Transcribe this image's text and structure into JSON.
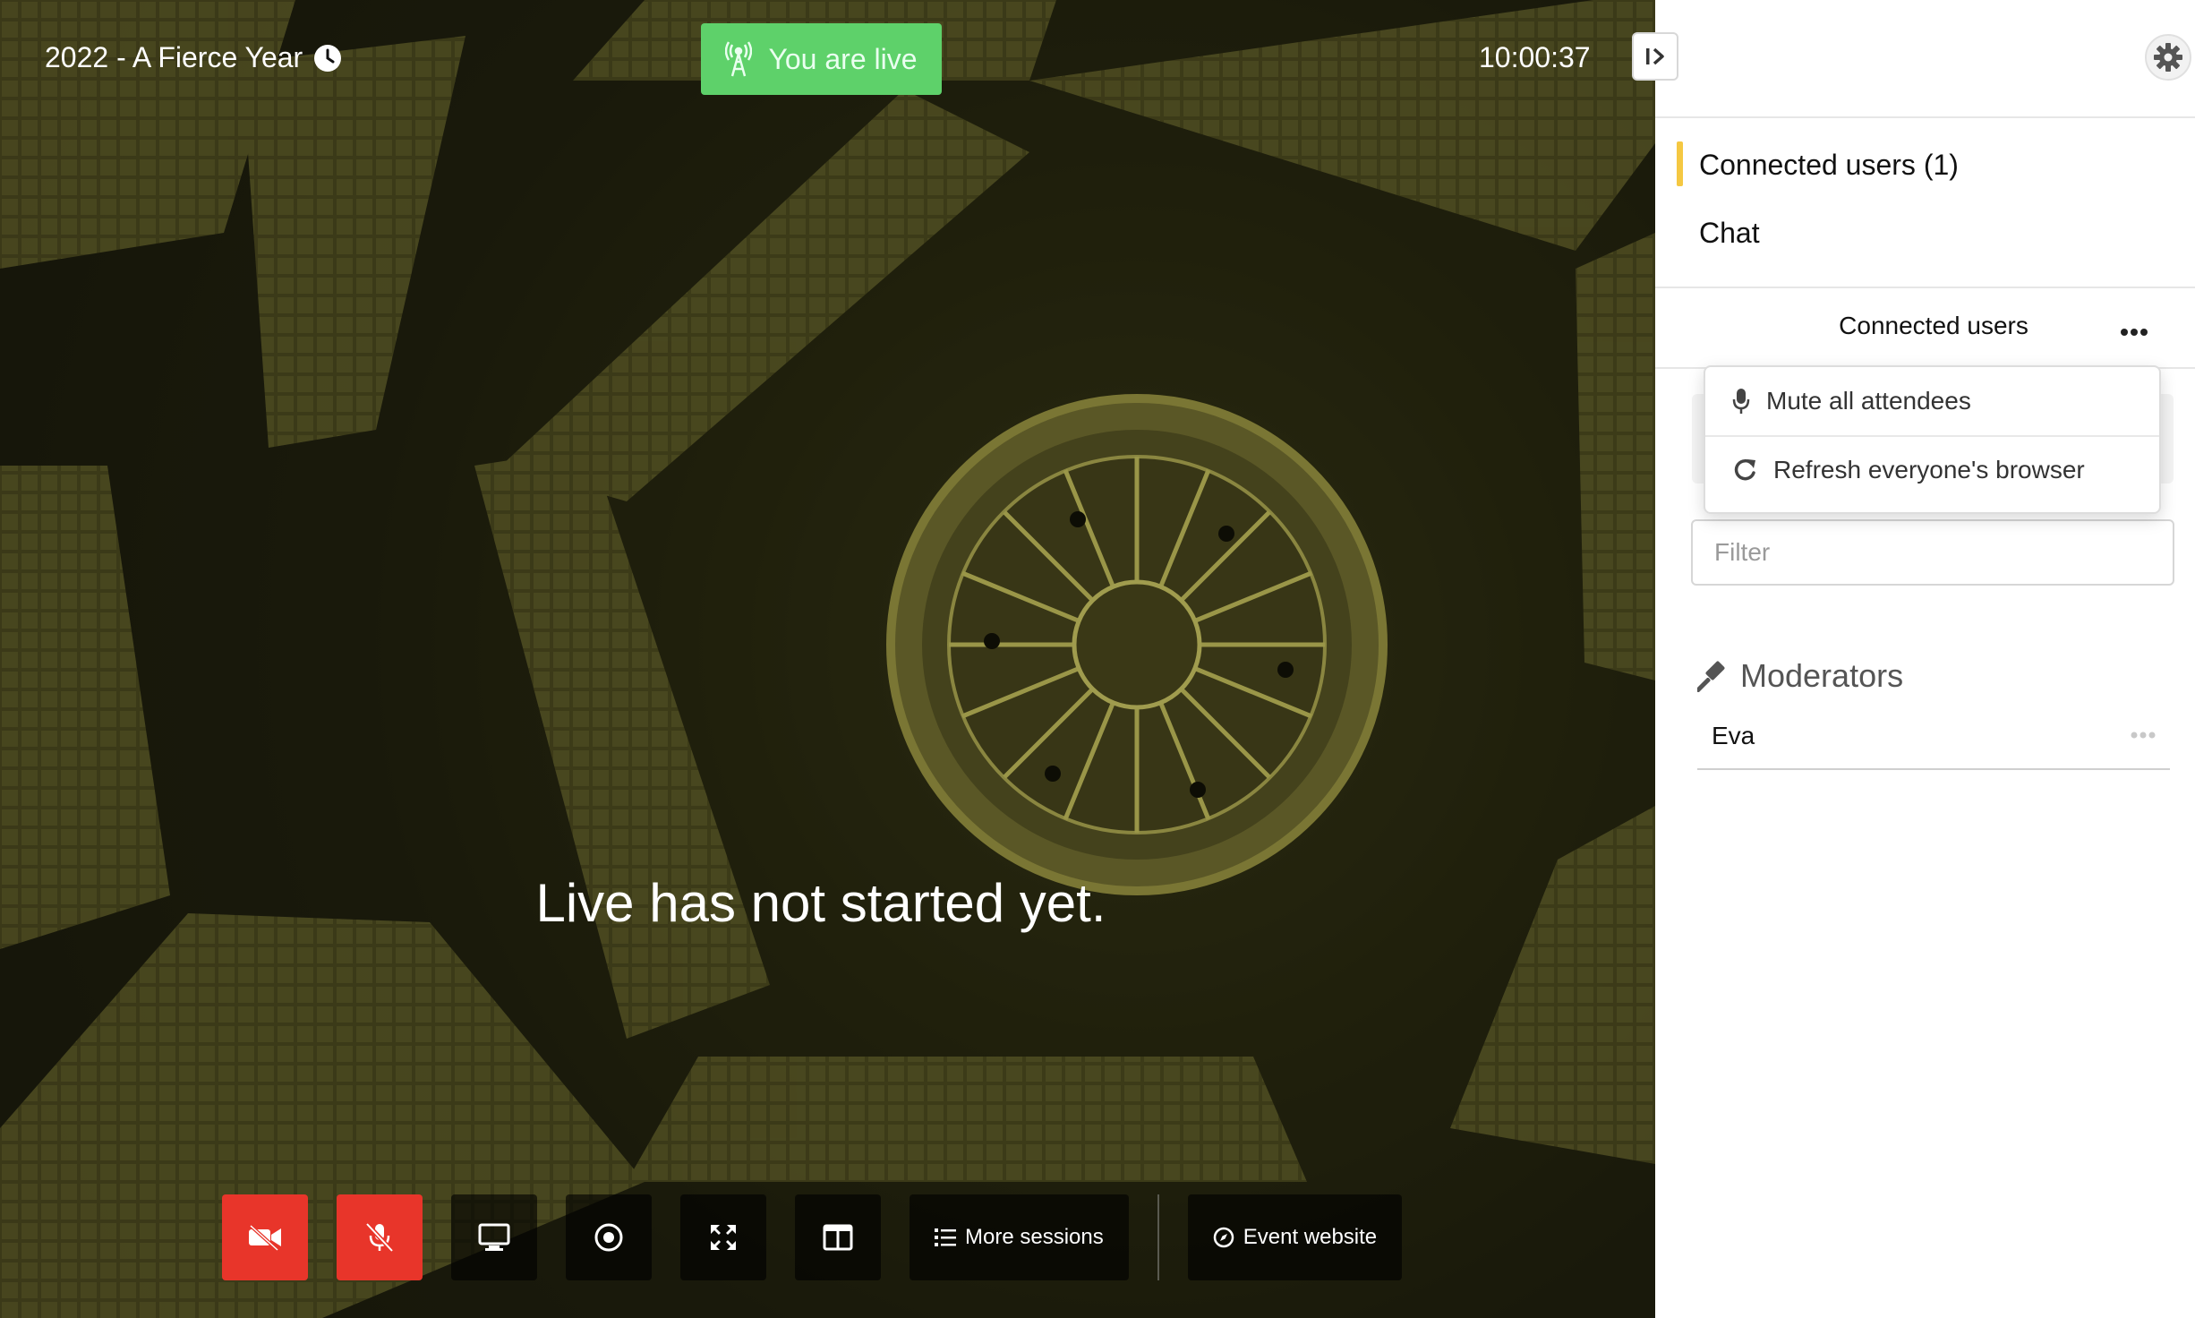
{
  "stage": {
    "event_title": "2022 - A Fierce Year",
    "live_badge": "You are live",
    "timer": "10:00:37",
    "message": "Live has not started yet.",
    "toolbar": {
      "more_sessions": "More sessions",
      "event_website": "Event website"
    }
  },
  "sidebar": {
    "nav": {
      "connected_users": "Connected users (1)",
      "chat": "Chat"
    },
    "section_title": "Connected users",
    "menu": {
      "mute_all": "Mute all attendees",
      "refresh_all": "Refresh everyone's browser"
    },
    "filter_placeholder": "Filter",
    "moderators_title": "Moderators",
    "moderators": [
      {
        "name": "Eva"
      }
    ]
  },
  "colors": {
    "live_green": "#5ed16a",
    "danger_red": "#e8352a",
    "accent_yellow": "#f5c842"
  },
  "icons": [
    "clock-icon",
    "antenna-icon",
    "collapse-sidebar-icon",
    "gear-icon",
    "video-off-icon",
    "mic-off-icon",
    "screen-share-icon",
    "record-icon",
    "fullscreen-icon",
    "layout-icon",
    "list-icon",
    "compass-icon",
    "microphone-icon",
    "refresh-icon",
    "gavel-icon",
    "more-icon"
  ]
}
